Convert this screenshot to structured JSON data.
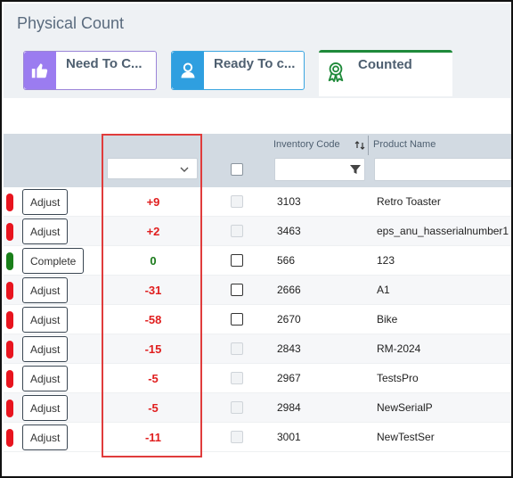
{
  "page": {
    "title": "Physical Count"
  },
  "tabs": [
    {
      "label": "Need To C...",
      "icon": "thumbs-up-icon",
      "color": "#9b7cf0"
    },
    {
      "label": "Ready To c...",
      "icon": "user-icon",
      "color": "#2f9fe0"
    },
    {
      "label": "Counted",
      "icon": "award-ribbon-icon",
      "color": "#1f8a3a"
    }
  ],
  "grid": {
    "columns": {
      "inventory_code": "Inventory Code",
      "product_name": "Product Name"
    },
    "colors": {
      "negative": "#e01e1e",
      "positive": "#e01e1e",
      "zero": "#1a7a1a",
      "status_red": "#e8141e",
      "status_green": "#1a7f1a"
    },
    "rows": [
      {
        "status": "red",
        "action": "Adjust",
        "variance": "+9",
        "checkbox": "disabled",
        "code": "3103",
        "name": "Retro Toaster"
      },
      {
        "status": "red",
        "action": "Adjust",
        "variance": "+2",
        "checkbox": "disabled",
        "code": "3463",
        "name": "eps_anu_hasserialnumber1"
      },
      {
        "status": "green",
        "action": "Complete",
        "variance": "0",
        "checkbox": "enabled",
        "code": "566",
        "name": "123"
      },
      {
        "status": "red",
        "action": "Adjust",
        "variance": "-31",
        "checkbox": "enabled",
        "code": "2666",
        "name": "A1"
      },
      {
        "status": "red",
        "action": "Adjust",
        "variance": "-58",
        "checkbox": "enabled",
        "code": "2670",
        "name": "Bike"
      },
      {
        "status": "red",
        "action": "Adjust",
        "variance": "-15",
        "checkbox": "disabled",
        "code": "2843",
        "name": "RM-2024"
      },
      {
        "status": "red",
        "action": "Adjust",
        "variance": "-5",
        "checkbox": "disabled",
        "code": "2967",
        "name": "TestsPro"
      },
      {
        "status": "red",
        "action": "Adjust",
        "variance": "-5",
        "checkbox": "disabled",
        "code": "2984",
        "name": "NewSerialP"
      },
      {
        "status": "red",
        "action": "Adjust",
        "variance": "-11",
        "checkbox": "disabled",
        "code": "3001",
        "name": "NewTestSer"
      }
    ]
  }
}
